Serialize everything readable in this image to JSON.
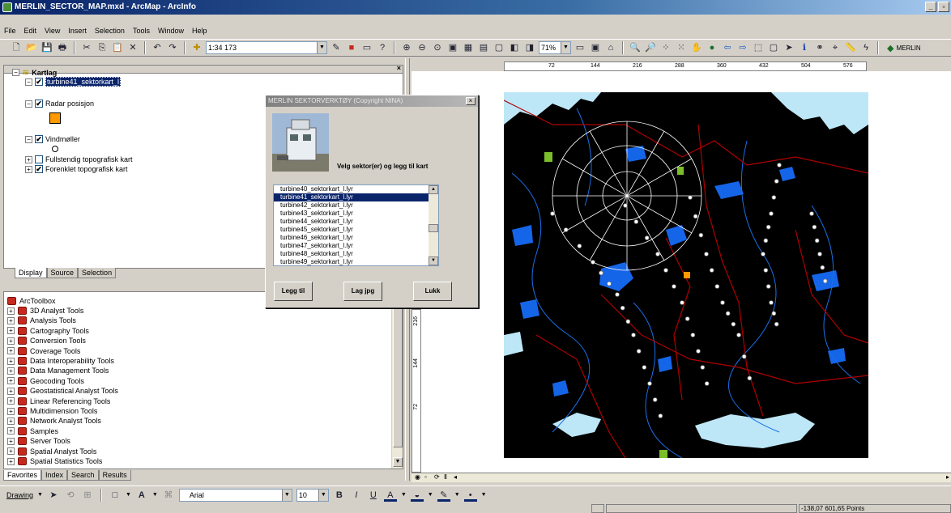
{
  "window": {
    "title": "MERLIN_SECTOR_MAP.mxd - ArcMap - ArcInfo"
  },
  "menu": [
    "File",
    "Edit",
    "View",
    "Insert",
    "Selection",
    "Tools",
    "Window",
    "Help"
  ],
  "toolbar": {
    "scale": "1:34 173",
    "zoom": "71%",
    "merlin_label": "MERLIN"
  },
  "toc": {
    "root": "Kartlag",
    "layers": [
      {
        "label": "turbine41_sektorkart_l",
        "checked": true,
        "selected": true
      },
      {
        "label": "Radar posisjon",
        "checked": true
      },
      {
        "label": "Vindmøller",
        "checked": true
      },
      {
        "label": "Fullstendig topografisk kart",
        "checked": false
      },
      {
        "label": "Forenklet topografisk kart",
        "checked": true
      }
    ],
    "tabs": [
      "Display",
      "Source",
      "Selection"
    ]
  },
  "toolbox": {
    "root": "ArcToolbox",
    "items": [
      "3D Analyst Tools",
      "Analysis Tools",
      "Cartography Tools",
      "Conversion Tools",
      "Coverage Tools",
      "Data Interoperability Tools",
      "Data Management Tools",
      "Geocoding Tools",
      "Geostatistical Analyst Tools",
      "Linear Referencing Tools",
      "Multidimension Tools",
      "Network Analyst Tools",
      "Samples",
      "Server Tools",
      "Spatial Analyst Tools",
      "Spatial Statistics Tools"
    ],
    "tabs": [
      "Favorites",
      "Index",
      "Search",
      "Results"
    ]
  },
  "ruler": {
    "top_ticks": [
      "72",
      "144",
      "216",
      "288",
      "360",
      "432",
      "504",
      "576"
    ],
    "left_ticks": [
      "216",
      "144",
      "72"
    ]
  },
  "dialog": {
    "title": "MERLIN SEKTORVERKTØY (Copyright NINA)",
    "prompt": "Velg sektor(er) og legg til kart",
    "files": [
      "turbine40_sektorkart_l.lyr",
      "turbine41_sektorkart_l.lyr",
      "turbine42_sektorkart_l.lyr",
      "turbine43_sektorkart_l.lyr",
      "turbine44_sektorkart_l.lyr",
      "turbine45_sektorkart_l.lyr",
      "turbine46_sektorkart_l.lyr",
      "turbine47_sektorkart_l.lyr",
      "turbine48_sektorkart_l.lyr",
      "turbine49_sektorkart_l.lyr"
    ],
    "selected_index": 1,
    "buttons": {
      "add": "Legg til",
      "jpg": "Lag jpg",
      "close": "Lukk"
    }
  },
  "drawing": {
    "label": "Drawing",
    "font": "Arial",
    "size": "10"
  },
  "status": {
    "coords": "-138,07  601,65 Points"
  },
  "colors": {
    "map_bg": "#000000",
    "water_light": "#bde7f7",
    "water": "#1565e8",
    "roads": "#b00000",
    "radar": "#ff9900",
    "selection": "#0a246a"
  }
}
